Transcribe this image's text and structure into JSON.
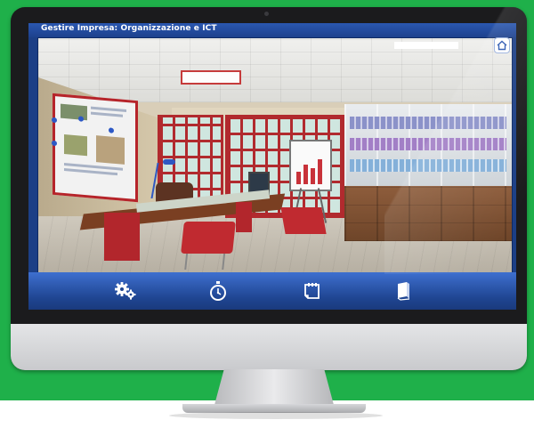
{
  "app": {
    "title": "Gestire Impresa: Organizzazione e ICT"
  },
  "toolbar": {
    "home_icon": "home-icon"
  },
  "nav": {
    "items": [
      {
        "icon": "gears-icon"
      },
      {
        "icon": "stopwatch-icon"
      },
      {
        "icon": "notepad-icon"
      },
      {
        "icon": "book-icon"
      }
    ]
  },
  "colors": {
    "background_green": "#1fb04a",
    "screen_blue": "#1c3f86",
    "nav_blue": "#2a57b0",
    "accent_red": "#b6242a"
  }
}
